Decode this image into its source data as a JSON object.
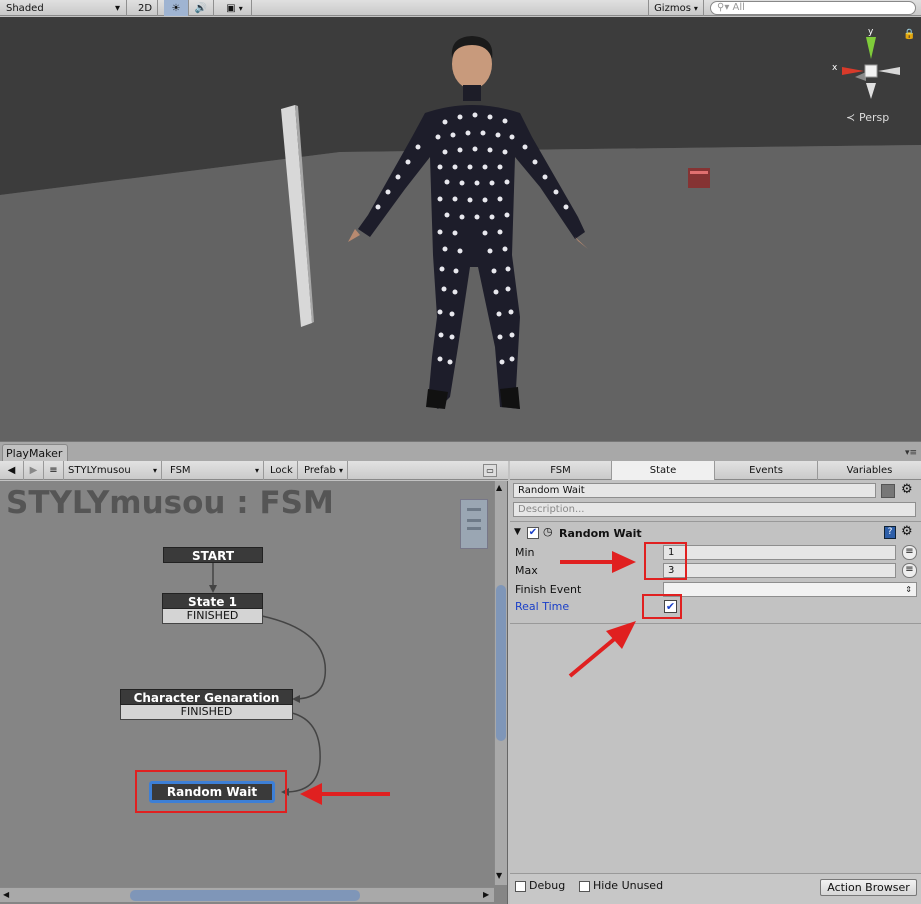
{
  "scene_toolbar": {
    "shading_mode": "Shaded",
    "mode_2d": "2D",
    "gizmos": "Gizmos",
    "search_placeholder": "All",
    "persp": "Persp",
    "axis_x": "x",
    "axis_y": "y"
  },
  "playmaker": {
    "tab": "PlayMaker",
    "toolbar": {
      "fsm_owner": "STYLYmusou",
      "fsm_name": "FSM",
      "lock": "Lock",
      "prefab": "Prefab"
    },
    "graph_title": "STYLYmusou : FSM",
    "start_label": "START",
    "states": [
      {
        "name": "State 1",
        "event": "FINISHED"
      },
      {
        "name": "Character Genaration",
        "event": "FINISHED"
      },
      {
        "name": "Random Wait",
        "event": ""
      }
    ]
  },
  "inspector": {
    "tabs": [
      "FSM",
      "State",
      "Events",
      "Variables"
    ],
    "active_tab": "State",
    "state_name": "Random Wait",
    "description_placeholder": "Description...",
    "action": {
      "title": "Random Wait",
      "enabled": true,
      "fields": [
        {
          "label": "Min",
          "value": "1"
        },
        {
          "label": "Max",
          "value": "3"
        },
        {
          "label": "Finish Event",
          "value": ""
        },
        {
          "label": "Real Time",
          "checked": true
        }
      ]
    },
    "footer": {
      "debug": "Debug",
      "hide_unused": "Hide Unused",
      "action_browser": "Action Browser"
    }
  },
  "colors": {
    "highlight_red": "#e02020",
    "selected_blue": "#3d7fd6",
    "link_blue": "#1a3fc8"
  }
}
